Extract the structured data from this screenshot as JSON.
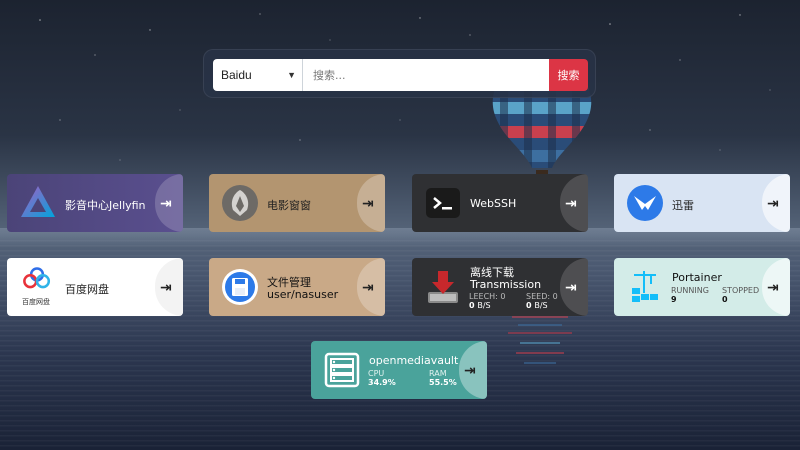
{
  "search": {
    "engine": "Baidu",
    "placeholder": "搜索...",
    "value": "",
    "button_label": "搜索"
  },
  "cards": {
    "jellyfin": {
      "name": "影音中心Jellyfin",
      "bg": "#5a4f8f"
    },
    "movies": {
      "name": "电影窗窗",
      "bg": "#b39570"
    },
    "webssh": {
      "name": "WebSSH",
      "bg": "#2f3033"
    },
    "xunlei": {
      "name": "迅雷",
      "bg": "#d9e4f3"
    },
    "baidupan": {
      "name": "百度网盘",
      "logo_text": "百度网盘",
      "bg": "#ffffff"
    },
    "filemanager": {
      "name_line1": "文件管理",
      "name_line2": "user/nasuser",
      "bg": "#c9a987"
    },
    "transmission": {
      "name_line1": "离线下载",
      "name_line2": "Transmission",
      "leech_label": "LEECH: 0",
      "leech_value": "0",
      "leech_unit": "B/S",
      "seed_label": "SEED: 0",
      "seed_value": "0",
      "seed_unit": "B/S",
      "bg": "#2f3033"
    },
    "portainer": {
      "name": "Portainer",
      "running_label": "RUNNING",
      "running_value": "9",
      "stopped_label": "STOPPED",
      "stopped_value": "0",
      "bg": "#d3ece8"
    },
    "omv": {
      "name": "openmediavault",
      "cpu_label": "CPU",
      "cpu_value": "34.9%",
      "ram_label": "RAM",
      "ram_value": "55.5%",
      "bg": "#4aa39b"
    }
  },
  "icons": {
    "launch": "launch-icon",
    "jellyfin": "jellyfin-icon",
    "movies": "movie-logo-icon",
    "webssh": "terminal-icon",
    "xunlei": "bird-icon",
    "baidupan": "baidu-cloud-icon",
    "filemanager": "floppy-disk-icon",
    "transmission": "transmission-icon",
    "portainer": "portainer-icon",
    "omv": "server-icon"
  }
}
